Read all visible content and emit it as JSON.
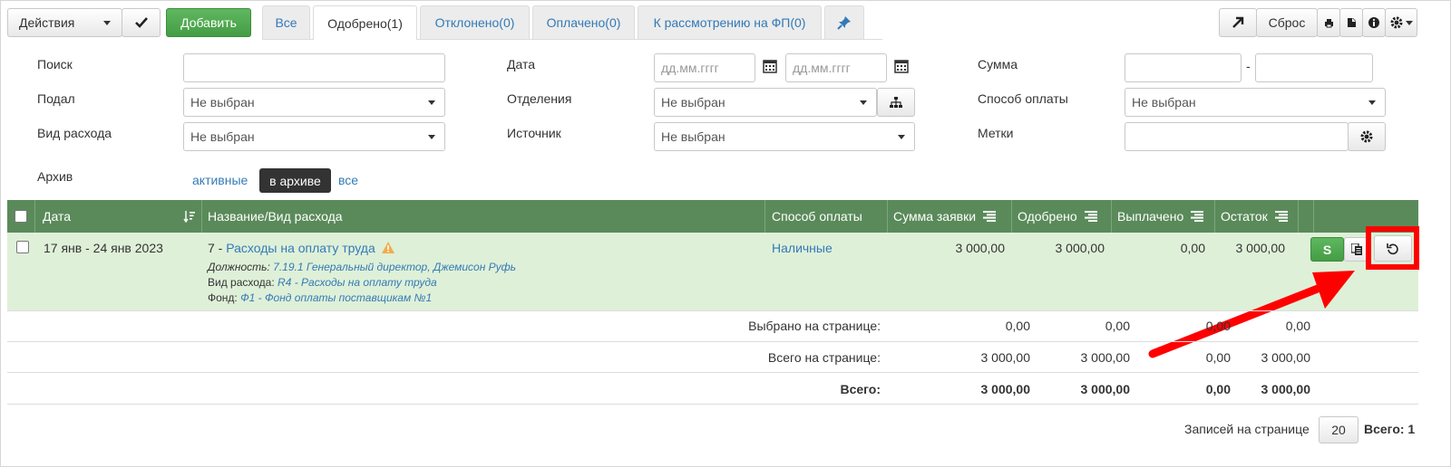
{
  "toolbar": {
    "actions_label": "Действия",
    "add_label": "Добавить",
    "reset_label": "Сброс"
  },
  "tabs": [
    {
      "label": "Все"
    },
    {
      "label": "Одобрено(1)"
    },
    {
      "label": "Отклонено(0)"
    },
    {
      "label": "Оплачено(0)"
    },
    {
      "label": "К рассмотрению на ФП(0)"
    }
  ],
  "filters": {
    "search_label": "Поиск",
    "submitted_label": "Подал",
    "submitted_value": "Не выбран",
    "expense_type_label": "Вид расхода",
    "expense_type_value": "Не выбран",
    "date_label": "Дата",
    "date_from_placeholder": "дд.мм.гггг",
    "date_to_placeholder": "дд.мм.гггг",
    "departments_label": "Отделения",
    "departments_value": "Не выбран",
    "source_label": "Источник",
    "source_value": "Не выбран",
    "amount_label": "Сумма",
    "amount_separator": "-",
    "payment_method_label": "Способ оплаты",
    "payment_method_value": "Не выбран",
    "tags_label": "Метки",
    "archive_label": "Архив",
    "archive_active": "активные",
    "archive_archived": "в архиве",
    "archive_all": "все"
  },
  "table": {
    "headers": {
      "date": "Дата",
      "name": "Название/Вид расхода",
      "payment_method": "Способ оплаты",
      "request_sum": "Сумма заявки",
      "approved": "Одобрено",
      "paid": "Выплачено",
      "remainder": "Остаток"
    },
    "rows": [
      {
        "date": "17 янв - 24 янв 2023",
        "number": "7 -",
        "name": "Расходы на оплату труда",
        "position_label": "Должность:",
        "position_value": "7.19.1 Генеральный директор, Джемисон Руфь",
        "expense_type_label": "Вид расхода:",
        "expense_type_value": "R4 - Расходы на оплату труда",
        "fund_label": "Фонд:",
        "fund_value": "Ф1 - Фонд оплаты поставщикам №1",
        "payment_method": "Наличные",
        "request_sum": "3 000,00",
        "approved": "3 000,00",
        "paid": "0,00",
        "remainder": "3 000,00",
        "pay_button": "S"
      }
    ],
    "totals": [
      {
        "label": "Выбрано на странице:",
        "request_sum": "0,00",
        "approved": "0,00",
        "paid": "0,00",
        "remainder": "0,00"
      },
      {
        "label": "Всего на странице:",
        "request_sum": "3 000,00",
        "approved": "3 000,00",
        "paid": "0,00",
        "remainder": "3 000,00"
      },
      {
        "label": "Всего:",
        "request_sum": "3 000,00",
        "approved": "3 000,00",
        "paid": "0,00",
        "remainder": "3 000,00"
      }
    ]
  },
  "pagination": {
    "per_page_label": "Записей на странице",
    "per_page_value": "20",
    "total_label": "Всего: 1"
  },
  "colors": {
    "header_green": "#5a8a5a",
    "row_green": "#dff0d8",
    "link_blue": "#337ab7",
    "highlight_red": "#ff0000"
  },
  "icons": [
    "caret-down-icon",
    "check-icon",
    "pin-icon",
    "arrow-up-right-icon",
    "print-icon",
    "export-icon",
    "info-icon",
    "gear-icon",
    "calendar-icon",
    "hierarchy-icon",
    "sort-icon",
    "warning-icon",
    "columns-icon",
    "undo-icon"
  ]
}
